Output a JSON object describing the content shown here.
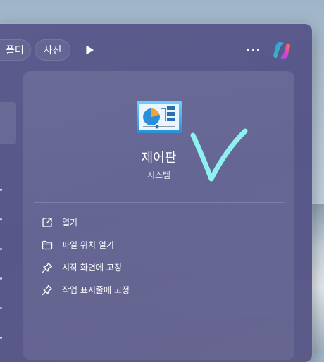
{
  "toolbar": {
    "filters": [
      {
        "label": "폴더"
      },
      {
        "label": "사진"
      }
    ],
    "play_icon": "play-icon",
    "more_label": "···",
    "copilot_icon": "copilot-icon"
  },
  "detail": {
    "app_icon": "control-panel-icon",
    "app_name": "제어판",
    "app_category": "시스템",
    "actions": [
      {
        "icon": "open-external-icon",
        "label": "열기"
      },
      {
        "icon": "folder-icon",
        "label": "파일 위치 열기"
      },
      {
        "icon": "pin-icon",
        "label": "시작 화면에 고정"
      },
      {
        "icon": "pin-icon",
        "label": "작업 표시줄에 고정"
      }
    ]
  },
  "overlay": {
    "checkmark_icon": "checkmark-annotation-icon",
    "checkmark_color": "#8ff0f0"
  },
  "colors": {
    "menu_background": "#59598a",
    "text": "#ffffff"
  }
}
